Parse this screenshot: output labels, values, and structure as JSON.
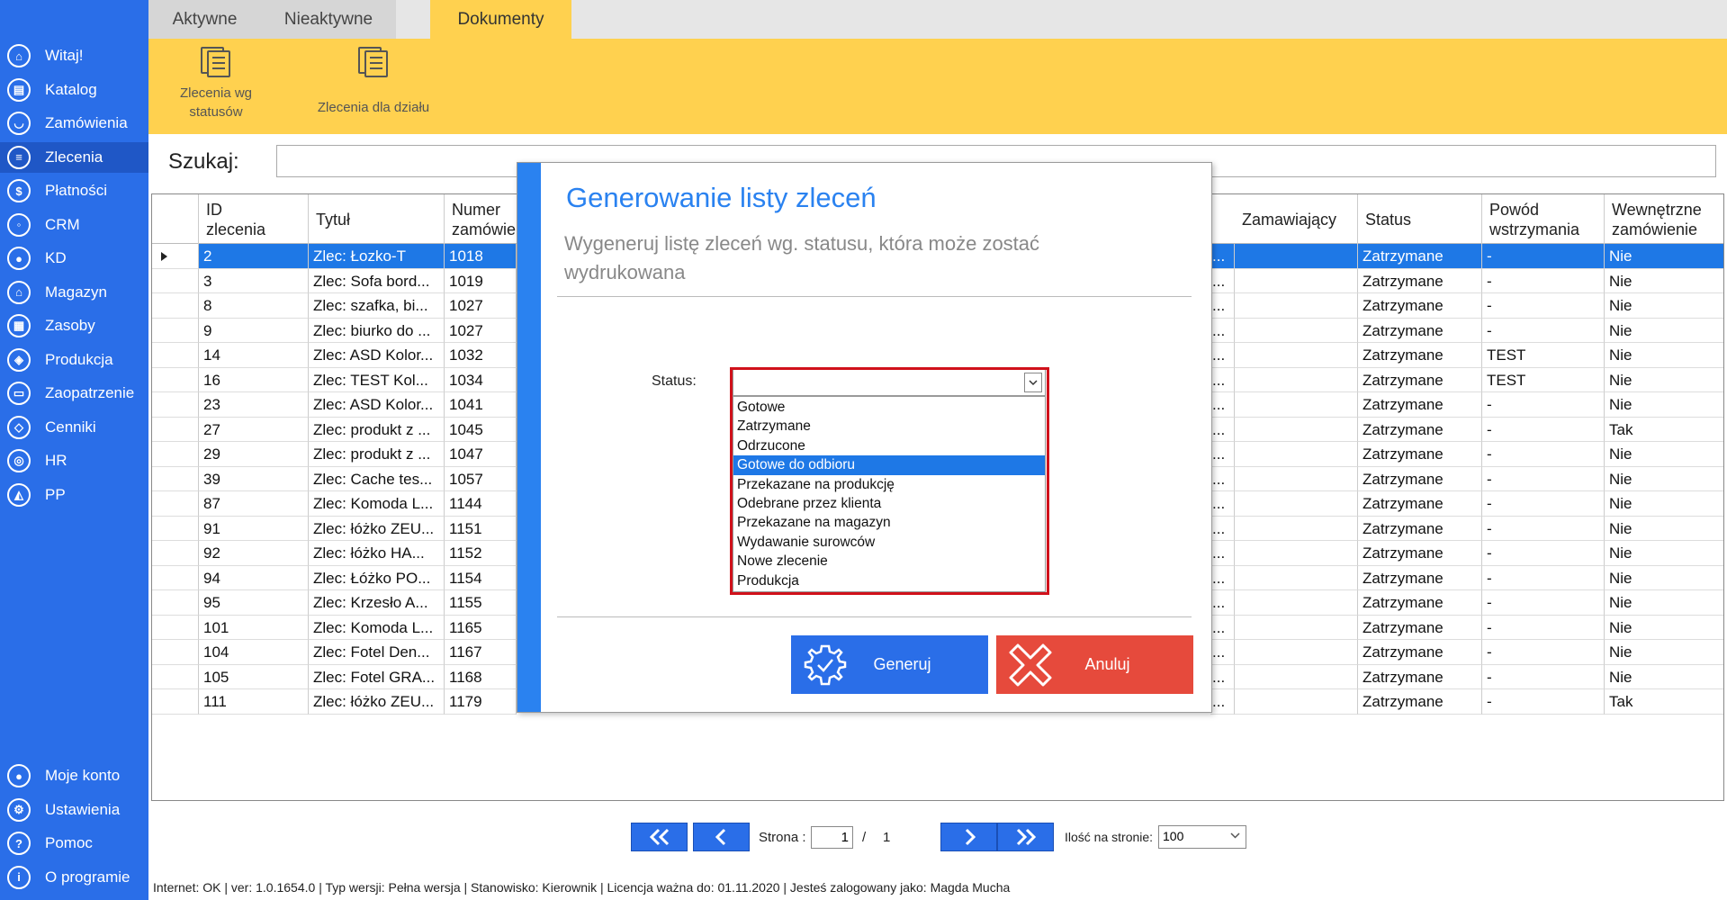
{
  "sidebar": {
    "items": [
      {
        "label": "Witaj!",
        "icon": "home-icon",
        "glyph": "⌂"
      },
      {
        "label": "Katalog",
        "icon": "catalog-icon",
        "glyph": "▤"
      },
      {
        "label": "Zamówienia",
        "icon": "cart-icon",
        "glyph": "◡"
      },
      {
        "label": "Zlecenia",
        "icon": "orders-list-icon",
        "glyph": "≡"
      },
      {
        "label": "Płatności",
        "icon": "dollar-icon",
        "glyph": "$"
      },
      {
        "label": "CRM",
        "icon": "crm-icon",
        "glyph": "◦"
      },
      {
        "label": "KD",
        "icon": "user-icon",
        "glyph": "●"
      },
      {
        "label": "Magazyn",
        "icon": "warehouse-icon",
        "glyph": "⌂"
      },
      {
        "label": "Zasoby",
        "icon": "resources-icon",
        "glyph": "▦"
      },
      {
        "label": "Produkcja",
        "icon": "production-icon",
        "glyph": "◈"
      },
      {
        "label": "Zaopatrzenie",
        "icon": "supply-icon",
        "glyph": "▭"
      },
      {
        "label": "Cenniki",
        "icon": "price-tag-icon",
        "glyph": "◇"
      },
      {
        "label": "HR",
        "icon": "hr-icon",
        "glyph": "◎"
      },
      {
        "label": "PP",
        "icon": "pp-icon",
        "glyph": "◭"
      }
    ],
    "bottom_items": [
      {
        "label": "Moje konto",
        "icon": "account-icon",
        "glyph": "●"
      },
      {
        "label": "Ustawienia",
        "icon": "settings-icon",
        "glyph": "⚙"
      },
      {
        "label": "Pomoc",
        "icon": "help-icon",
        "glyph": "?"
      },
      {
        "label": "O programie",
        "icon": "info-icon",
        "glyph": "i"
      }
    ]
  },
  "tabs": [
    {
      "label": "Aktywne"
    },
    {
      "label": "Nieaktywne"
    },
    {
      "label": "Dokumenty"
    }
  ],
  "ribbon": {
    "btn1": {
      "line1": "Zlecenia wg",
      "line2": "statusów"
    },
    "btn2": {
      "label": "Zlecenia dla działu"
    }
  },
  "search": {
    "label": "Szukaj:",
    "value": ""
  },
  "grid": {
    "headers": {
      "id_l1": "ID",
      "id_l2": "zlecenia",
      "title": "Tytuł",
      "number_l1": "Numer",
      "number_l2": "zamówie",
      "client": "Zamawiający",
      "status": "Status",
      "reason_l1": "Powód",
      "reason_l2": "wstrzymania",
      "internal_l1": "Wewnętrzne",
      "internal_l2": "zamówienie"
    },
    "rows": [
      {
        "id": "2",
        "title": "Zlec: Łozko-T",
        "num": "1018",
        "status": "Zatrzymane",
        "reason": "-",
        "internal": "Nie"
      },
      {
        "id": "3",
        "title": "Zlec: Sofa bord...",
        "num": "1019",
        "status": "Zatrzymane",
        "reason": "-",
        "internal": "Nie"
      },
      {
        "id": "8",
        "title": "Zlec: szafka, bi...",
        "num": "1027",
        "status": "Zatrzymane",
        "reason": "-",
        "internal": "Nie"
      },
      {
        "id": "9",
        "title": "Zlec: biurko do ...",
        "num": "1027",
        "status": "Zatrzymane",
        "reason": "-",
        "internal": "Nie"
      },
      {
        "id": "14",
        "title": "Zlec: ASD Kolor...",
        "num": "1032",
        "status": "Zatrzymane",
        "reason": "TEST",
        "internal": "Nie"
      },
      {
        "id": "16",
        "title": "Zlec: TEST Kol...",
        "num": "1034",
        "status": "Zatrzymane",
        "reason": "TEST",
        "internal": "Nie"
      },
      {
        "id": "23",
        "title": "Zlec: ASD Kolor...",
        "num": "1041",
        "status": "Zatrzymane",
        "reason": "-",
        "internal": "Nie"
      },
      {
        "id": "27",
        "title": "Zlec: produkt z ...",
        "num": "1045",
        "status": "Zatrzymane",
        "reason": "-",
        "internal": "Tak"
      },
      {
        "id": "29",
        "title": "Zlec: produkt z ...",
        "num": "1047",
        "status": "Zatrzymane",
        "reason": "-",
        "internal": "Nie"
      },
      {
        "id": "39",
        "title": "Zlec: Cache tes...",
        "num": "1057",
        "status": "Zatrzymane",
        "reason": "-",
        "internal": "Nie"
      },
      {
        "id": "87",
        "title": "Zlec: Komoda L...",
        "num": "1144",
        "status": "Zatrzymane",
        "reason": "-",
        "internal": "Nie"
      },
      {
        "id": "91",
        "title": "Zlec: łóżko ZEU...",
        "num": "1151",
        "status": "Zatrzymane",
        "reason": "-",
        "internal": "Nie"
      },
      {
        "id": "92",
        "title": "Zlec: łóżko HA...",
        "num": "1152",
        "status": "Zatrzymane",
        "reason": "-",
        "internal": "Nie"
      },
      {
        "id": "94",
        "title": "Zlec: Łóżko PO...",
        "num": "1154",
        "status": "Zatrzymane",
        "reason": "-",
        "internal": "Nie"
      },
      {
        "id": "95",
        "title": "Zlec: Krzesło A...",
        "num": "1155",
        "status": "Zatrzymane",
        "reason": "-",
        "internal": "Nie"
      },
      {
        "id": "101",
        "title": "Zlec: Komoda L...",
        "num": "1165",
        "status": "Zatrzymane",
        "reason": "-",
        "internal": "Nie"
      },
      {
        "id": "104",
        "title": "Zlec: Fotel Den...",
        "num": "1167",
        "status": "Zatrzymane",
        "reason": "-",
        "internal": "Nie"
      },
      {
        "id": "105",
        "title": "Zlec: Fotel GRA...",
        "num": "1168",
        "status": "Zatrzymane",
        "reason": "-",
        "internal": "Nie"
      },
      {
        "id": "111",
        "title": "Zlec: łóżko ZEU...",
        "num": "1179",
        "status": "Zatrzymane",
        "reason": "-",
        "internal": "Tak"
      }
    ],
    "truncated_marker": "..."
  },
  "modal": {
    "title": "Generowanie listy zleceń",
    "subtitle": "Wygeneruj listę zleceń wg. statusu, która może zostać wydrukowana",
    "status_label": "Status:",
    "status_value": "",
    "options": [
      "Gotowe",
      "Zatrzymane",
      "Odrzucone",
      "Gotowe do odbioru",
      "Przekazane na produkcję",
      "Odebrane przez klienta",
      "Przekazane na magazyn",
      "Wydawanie surowców",
      "Nowe zlecenie",
      "Produkcja"
    ],
    "generate_label": "Generuj",
    "cancel_label": "Anuluj"
  },
  "pager": {
    "page_label": "Strona :",
    "current_page": "1",
    "separator": "/",
    "total_pages": "1",
    "per_page_label": "Ilość na stronie:",
    "per_page_value": "100"
  },
  "statusbar": {
    "text": "Internet: OK  |   ver: 1.0.1654.0   |   Typ wersji: Pełna wersja   |   Stanowisko: Kierownik   |   Licencja ważna do: 01.11.2020  |   Jesteś zalogowany jako: Magda Mucha"
  },
  "colors": {
    "sidebar": "#2a6ee8",
    "ribbon": "#ffd14f",
    "accent": "#2a82f0",
    "selection": "#1e78e6",
    "cancel": "#e64a3c",
    "highlight_border": "#d0111b"
  }
}
